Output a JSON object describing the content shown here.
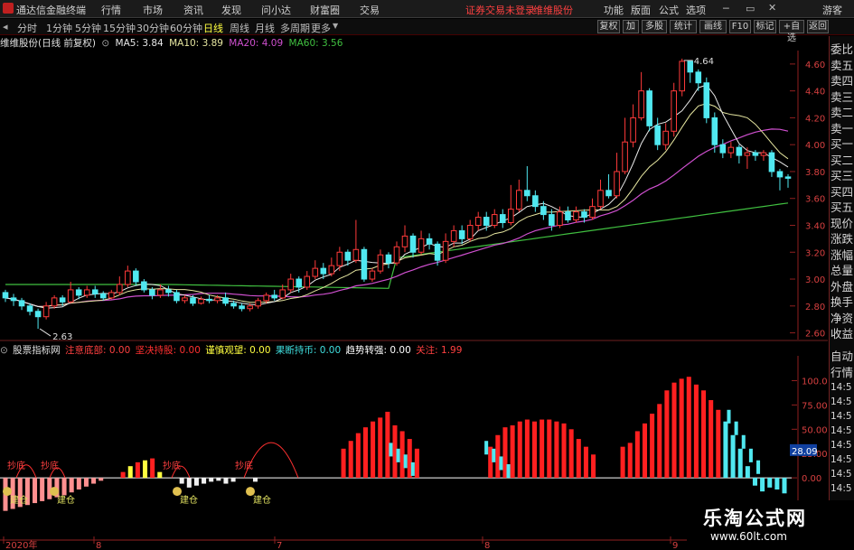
{
  "menubar": {
    "app_title": "通达信金融终端",
    "items": [
      "行情",
      "市场",
      "资讯",
      "发现",
      "问小达",
      "财富圈",
      "交易"
    ],
    "notice": "证券交易未登录",
    "stock_name": "维维股份",
    "right_items": [
      "功能",
      "版面",
      "公式",
      "选项"
    ],
    "guest": "游客"
  },
  "toolbar": {
    "periods": [
      "分时",
      "1分钟",
      "5分钟",
      "15分钟",
      "30分钟",
      "60分钟",
      "日线",
      "周线",
      "月线",
      "多周期",
      "更多"
    ],
    "active_period": "日线",
    "right_buttons": [
      "复权",
      "加",
      "多股",
      "统计",
      "画线",
      "F10",
      "标记",
      "+自选",
      "返回"
    ]
  },
  "main_chart": {
    "stock_label": "维维股份(日线 前复权)",
    "ma": [
      {
        "name": "MA5",
        "value": "3.84",
        "color": "#e8e8e8"
      },
      {
        "name": "MA10",
        "value": "3.89",
        "color": "#e6e6a0"
      },
      {
        "name": "MA20",
        "value": "4.09",
        "color": "#d050d0"
      },
      {
        "name": "MA60",
        "value": "3.56",
        "color": "#40c040"
      }
    ],
    "price_labels": [
      "4.60",
      "4.40",
      "4.20",
      "4.00",
      "3.80",
      "3.60",
      "3.40",
      "3.20",
      "3.00",
      "2.80",
      "2.60"
    ],
    "high_label": "4.64",
    "low_label": "2.63"
  },
  "chart_data": [
    {
      "type": "candlestick",
      "title": "维维股份(日线 前复权)",
      "ylim": [
        2.55,
        4.7
      ],
      "ohlc_summary": {
        "low": 2.63,
        "high": 4.64,
        "last": 3.75
      },
      "candles": [
        [
          2.9,
          2.86,
          2.92,
          2.83
        ],
        [
          2.86,
          2.84,
          2.89,
          2.8
        ],
        [
          2.84,
          2.8,
          2.86,
          2.77
        ],
        [
          2.8,
          2.76,
          2.82,
          2.73
        ],
        [
          2.76,
          2.72,
          2.78,
          2.63
        ],
        [
          2.72,
          2.8,
          2.83,
          2.7
        ],
        [
          2.8,
          2.86,
          2.88,
          2.78
        ],
        [
          2.86,
          2.83,
          2.88,
          2.8
        ],
        [
          2.83,
          2.92,
          2.98,
          2.82
        ],
        [
          2.92,
          2.88,
          2.94,
          2.85
        ],
        [
          2.88,
          2.92,
          2.95,
          2.86
        ],
        [
          2.92,
          2.89,
          2.95,
          2.86
        ],
        [
          2.89,
          2.86,
          2.91,
          2.84
        ],
        [
          2.86,
          2.9,
          2.92,
          2.85
        ],
        [
          2.9,
          2.96,
          3.02,
          2.88
        ],
        [
          2.96,
          3.06,
          3.1,
          2.94
        ],
        [
          3.06,
          2.98,
          3.08,
          2.95
        ],
        [
          2.98,
          2.92,
          3.0,
          2.9
        ],
        [
          2.92,
          2.88,
          2.94,
          2.85
        ],
        [
          2.88,
          2.92,
          2.96,
          2.86
        ],
        [
          2.92,
          2.9,
          2.95,
          2.87
        ],
        [
          2.9,
          2.84,
          2.92,
          2.82
        ],
        [
          2.84,
          2.86,
          2.88,
          2.82
        ],
        [
          2.86,
          2.82,
          2.88,
          2.8
        ],
        [
          2.82,
          2.85,
          2.87,
          2.81
        ],
        [
          2.85,
          2.84,
          2.88,
          2.82
        ],
        [
          2.84,
          2.86,
          2.88,
          2.82
        ],
        [
          2.86,
          2.82,
          2.9,
          2.8
        ],
        [
          2.82,
          2.8,
          2.84,
          2.78
        ],
        [
          2.8,
          2.78,
          2.82,
          2.76
        ],
        [
          2.78,
          2.8,
          2.82,
          2.76
        ],
        [
          2.8,
          2.84,
          2.86,
          2.78
        ],
        [
          2.84,
          2.88,
          2.9,
          2.82
        ],
        [
          2.88,
          2.86,
          2.92,
          2.84
        ],
        [
          2.86,
          2.92,
          2.96,
          2.85
        ],
        [
          2.92,
          3.0,
          3.04,
          2.9
        ],
        [
          3.0,
          2.94,
          3.02,
          2.9
        ],
        [
          2.94,
          3.02,
          3.06,
          2.92
        ],
        [
          3.02,
          3.08,
          3.14,
          3.0
        ],
        [
          3.08,
          3.04,
          3.12,
          3.0
        ],
        [
          3.04,
          3.1,
          3.16,
          3.02
        ],
        [
          3.1,
          3.2,
          3.24,
          3.06
        ],
        [
          3.2,
          3.14,
          3.22,
          3.1
        ],
        [
          3.14,
          3.22,
          3.44,
          3.12
        ],
        [
          3.22,
          3.0,
          3.24,
          2.98
        ],
        [
          3.0,
          3.06,
          3.08,
          2.98
        ],
        [
          3.06,
          3.18,
          3.22,
          3.04
        ],
        [
          3.18,
          3.12,
          3.2,
          3.08
        ],
        [
          3.12,
          3.24,
          3.28,
          3.1
        ],
        [
          3.24,
          3.32,
          3.4,
          3.2
        ],
        [
          3.32,
          3.2,
          3.34,
          3.16
        ],
        [
          3.2,
          3.3,
          3.36,
          3.18
        ],
        [
          3.3,
          3.26,
          3.34,
          3.22
        ],
        [
          3.26,
          3.14,
          3.28,
          3.1
        ],
        [
          3.14,
          3.28,
          3.34,
          3.12
        ],
        [
          3.28,
          3.36,
          3.4,
          3.24
        ],
        [
          3.36,
          3.3,
          3.4,
          3.26
        ],
        [
          3.3,
          3.4,
          3.44,
          3.28
        ],
        [
          3.4,
          3.46,
          3.5,
          3.36
        ],
        [
          3.46,
          3.4,
          3.5,
          3.36
        ],
        [
          3.4,
          3.48,
          3.52,
          3.38
        ],
        [
          3.48,
          3.42,
          3.52,
          3.38
        ],
        [
          3.42,
          3.52,
          3.7,
          3.4
        ],
        [
          3.52,
          3.66,
          3.74,
          3.5
        ],
        [
          3.66,
          3.62,
          3.84,
          3.58
        ],
        [
          3.62,
          3.54,
          3.66,
          3.5
        ],
        [
          3.54,
          3.48,
          3.58,
          3.44
        ],
        [
          3.48,
          3.4,
          3.52,
          3.36
        ],
        [
          3.4,
          3.5,
          3.54,
          3.38
        ],
        [
          3.5,
          3.44,
          3.54,
          3.42
        ],
        [
          3.44,
          3.5,
          3.54,
          3.42
        ],
        [
          3.5,
          3.46,
          3.52,
          3.42
        ],
        [
          3.46,
          3.54,
          3.6,
          3.44
        ],
        [
          3.54,
          3.66,
          3.74,
          3.52
        ],
        [
          3.66,
          3.62,
          3.78,
          3.6
        ],
        [
          3.62,
          3.8,
          3.94,
          3.6
        ],
        [
          3.8,
          4.02,
          4.2,
          3.78
        ],
        [
          4.02,
          4.2,
          4.3,
          3.98
        ],
        [
          4.2,
          4.4,
          4.54,
          4.18
        ],
        [
          4.4,
          4.14,
          4.42,
          4.1
        ],
        [
          4.14,
          4.0,
          4.2,
          3.96
        ],
        [
          4.0,
          4.1,
          4.16,
          3.96
        ],
        [
          4.1,
          4.4,
          4.46,
          4.06
        ],
        [
          4.4,
          4.62,
          4.64,
          4.36
        ],
        [
          4.62,
          4.54,
          4.62,
          4.46
        ],
        [
          4.54,
          4.46,
          4.56,
          4.4
        ],
        [
          4.46,
          4.2,
          4.5,
          4.16
        ],
        [
          4.2,
          4.0,
          4.24,
          3.94
        ],
        [
          4.0,
          3.94,
          4.04,
          3.9
        ],
        [
          3.94,
          3.98,
          4.02,
          3.9
        ],
        [
          3.98,
          3.92,
          4.0,
          3.86
        ],
        [
          3.92,
          3.94,
          3.98,
          3.82
        ],
        [
          3.94,
          3.92,
          3.96,
          3.88
        ],
        [
          3.92,
          3.94,
          3.96,
          3.88
        ],
        [
          3.94,
          3.8,
          3.96,
          3.76
        ],
        [
          3.8,
          3.76,
          3.82,
          3.66
        ],
        [
          3.76,
          3.75,
          3.78,
          3.68
        ]
      ]
    },
    {
      "type": "bar",
      "title": "股票指标网",
      "ylim": [
        -12,
        120
      ],
      "series_labels": [
        {
          "name": "注意底部",
          "value": "0.00",
          "color": "#ff4040"
        },
        {
          "name": "坚决持股",
          "value": "0.00",
          "color": "#ff3030"
        },
        {
          "name": "谨慎观望",
          "value": "0.00",
          "color": "#ffff40"
        },
        {
          "name": "果断持币",
          "value": "0.00",
          "color": "#40e0e0"
        },
        {
          "name": "趋势转强",
          "value": "0.00",
          "color": "#ffffff"
        },
        {
          "name": "关注",
          "value": "1.99",
          "color": "#ff4040"
        }
      ],
      "scale_labels": [
        "100.0",
        "75.00",
        "50.00",
        "25.00",
        "0.00"
      ],
      "current_value": "28.09",
      "annotations": [
        "抄底",
        "抄底",
        "抄底",
        "抄底",
        "建仓",
        "建仓",
        "建仓",
        "建仓"
      ],
      "x_labels": [
        "2020年",
        "8",
        "7",
        "8",
        "9"
      ]
    }
  ],
  "right_panel": {
    "items": [
      "委比",
      "卖五",
      "卖四",
      "卖三",
      "卖二",
      "卖一",
      "买一",
      "买二",
      "买三",
      "买四",
      "买五",
      "现价",
      "涨跌",
      "涨幅",
      "总量",
      "外盘",
      "换手",
      "净资",
      "收益"
    ],
    "lower_items": [
      "自动",
      "行情"
    ],
    "times": [
      "14:5",
      "14:5",
      "14:5",
      "14:5",
      "14:5",
      "14:5",
      "14:5",
      "14:5"
    ]
  },
  "watermark": {
    "line1": "乐淘公式网",
    "line2": "www.60lt.com"
  }
}
